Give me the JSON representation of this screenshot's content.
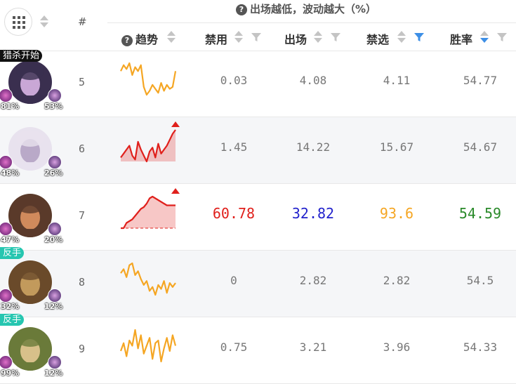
{
  "header": {
    "hash": "#",
    "group_title": "出场越低，波动越大（%）",
    "group_help": "?",
    "columns": {
      "trend": "趋势",
      "trend_help": "?",
      "ban": "禁用",
      "appear": "出场",
      "ban_pick": "禁选",
      "win": "胜率"
    }
  },
  "rows": [
    {
      "rank": "5",
      "tag": "猎杀开始",
      "tag_color": "#111111",
      "pct_left": "81%",
      "pct_right": "53%",
      "ban": "0.03",
      "appear": "4.08",
      "ban_pick": "4.11",
      "win": "54.77",
      "trend_color": "#f5a623",
      "trend": [
        6,
        3,
        5,
        2,
        8,
        4,
        6,
        3,
        14,
        18,
        16,
        13,
        15,
        17,
        12,
        16,
        13,
        15,
        14,
        6
      ]
    },
    {
      "rank": "6",
      "tag": "",
      "pct_left": "48%",
      "pct_right": "26%",
      "ban": "1.45",
      "appear": "14.22",
      "ban_pick": "15.67",
      "win": "54.67",
      "trend_color": "#e0201c",
      "trend": [
        16,
        14,
        12,
        10,
        15,
        17,
        8,
        12,
        15,
        18,
        13,
        11,
        16,
        9,
        14,
        12,
        10,
        7,
        4,
        2
      ]
    },
    {
      "rank": "7",
      "tag": "",
      "pct_left": "47%",
      "pct_right": "20%",
      "ban": "60.78",
      "appear": "32.82",
      "ban_pick": "93.6",
      "win": "54.59",
      "trend_color": "#e0201c",
      "trend": [
        20,
        20,
        17,
        16,
        15,
        13,
        11,
        9,
        8,
        6,
        3,
        2,
        3,
        4,
        5,
        6,
        7,
        7,
        7,
        7
      ]
    },
    {
      "rank": "8",
      "tag": "反手",
      "tag_color": "#26c6b0",
      "pct_left": "32%",
      "pct_right": "12%",
      "ban": "0",
      "appear": "2.82",
      "ban_pick": "2.82",
      "win": "54.5",
      "trend_color": "#f5a623",
      "trend": [
        8,
        6,
        10,
        4,
        3,
        9,
        7,
        11,
        14,
        12,
        17,
        15,
        19,
        14,
        16,
        12,
        18,
        13,
        15,
        13
      ]
    },
    {
      "rank": "9",
      "tag": "反手",
      "tag_color": "#26c6b0",
      "pct_left": "99%",
      "pct_right": "12%",
      "ban": "0.75",
      "appear": "3.21",
      "ban_pick": "3.96",
      "win": "54.33",
      "trend_color": "#f5a623",
      "trend": [
        12,
        9,
        14,
        8,
        10,
        4,
        11,
        6,
        13,
        10,
        7,
        15,
        9,
        8,
        16,
        11,
        7,
        12,
        6,
        10
      ]
    }
  ],
  "highlight_colors": {
    "ban": "#e0201c",
    "appear": "#2222cc",
    "ban_pick": "#f5a623",
    "win": "#2a8a2a"
  }
}
